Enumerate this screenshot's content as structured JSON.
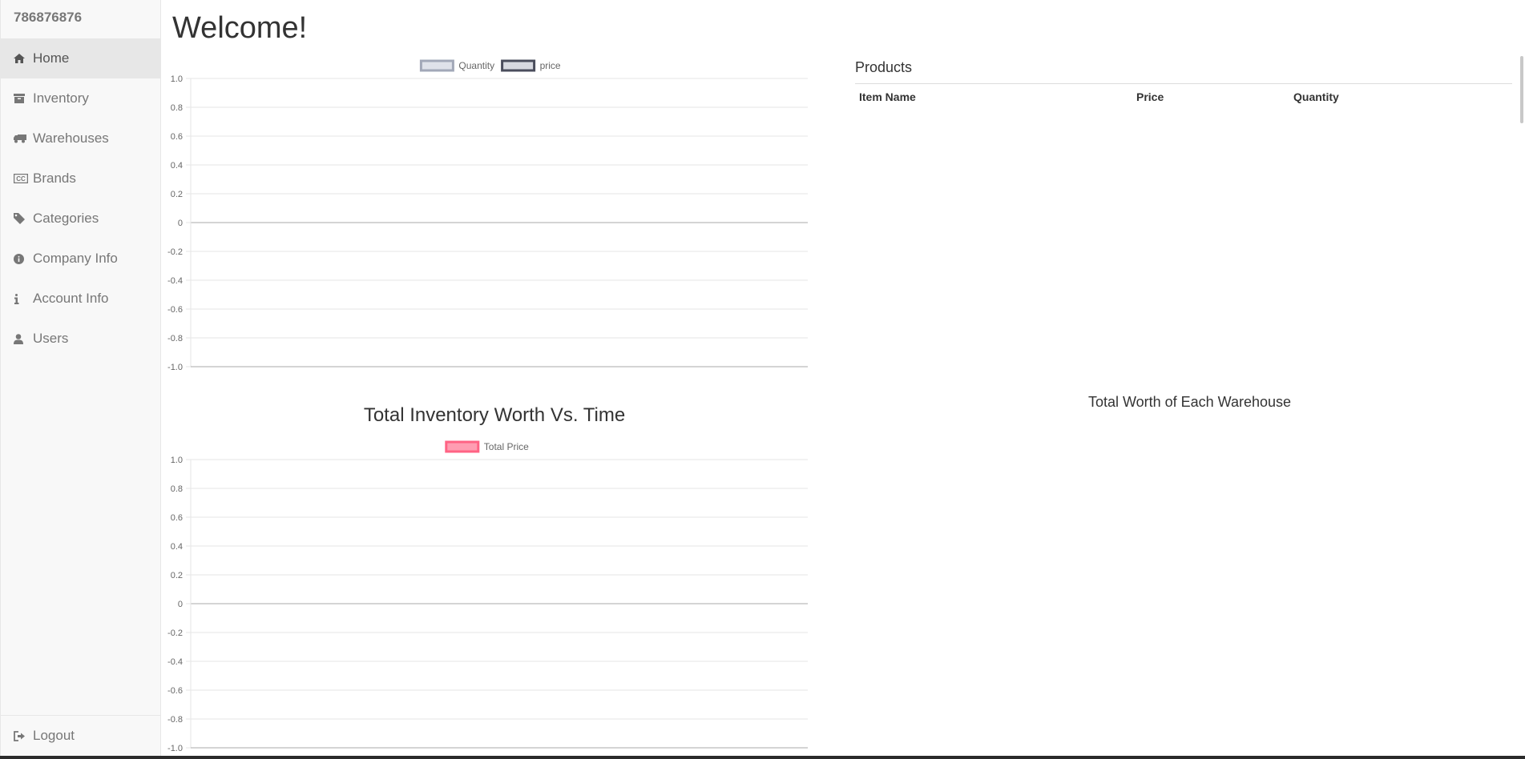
{
  "sidebar": {
    "brand": "786876876",
    "items": [
      {
        "label": "Home",
        "icon": "home-icon",
        "active": true
      },
      {
        "label": "Inventory",
        "icon": "archive-icon",
        "active": false
      },
      {
        "label": "Warehouses",
        "icon": "truck-icon",
        "active": false
      },
      {
        "label": "Brands",
        "icon": "cc-icon",
        "active": false
      },
      {
        "label": "Categories",
        "icon": "tag-icon",
        "active": false
      },
      {
        "label": "Company Info",
        "icon": "info-circle-icon",
        "active": false
      },
      {
        "label": "Account Info",
        "icon": "info-icon",
        "active": false
      },
      {
        "label": "Users",
        "icon": "user-icon",
        "active": false
      }
    ],
    "logout": {
      "label": "Logout",
      "icon": "sign-out-icon"
    }
  },
  "main": {
    "welcome": "Welcome!"
  },
  "products": {
    "title": "Products",
    "columns": [
      "Item Name",
      "Price",
      "Quantity"
    ],
    "rows": []
  },
  "warehouse_chart": {
    "title": "Total Worth of Each Warehouse"
  },
  "colors": {
    "quantity_border": "#a2a8b8",
    "quantity_fill": "#dfe2ea",
    "price_border": "#4a4d5c",
    "price_fill": "#d7d9e0",
    "total_price_border": "#ff6384",
    "total_price_fill": "#ff9db2"
  },
  "chart_data": [
    {
      "type": "line",
      "title": "",
      "series": [
        {
          "name": "Quantity",
          "values": []
        },
        {
          "name": "price",
          "values": []
        }
      ],
      "x": [],
      "ylim": [
        -1.0,
        1.0
      ],
      "yticks": [
        "1.0",
        "0.8",
        "0.6",
        "0.4",
        "0.2",
        "0",
        "-0.2",
        "-0.4",
        "-0.6",
        "-0.8",
        "-1.0"
      ],
      "grid": true,
      "legend": "top"
    },
    {
      "type": "line",
      "title": "Total Inventory Worth Vs. Time",
      "series": [
        {
          "name": "Total Price",
          "values": []
        }
      ],
      "x": [],
      "ylim": [
        -1.0,
        1.0
      ],
      "yticks": [
        "1.0",
        "0.8",
        "0.6",
        "0.4",
        "0.2",
        "0",
        "-0.2",
        "-0.4",
        "-0.6",
        "-0.8",
        "-1.0"
      ],
      "grid": true,
      "legend": "top"
    }
  ]
}
